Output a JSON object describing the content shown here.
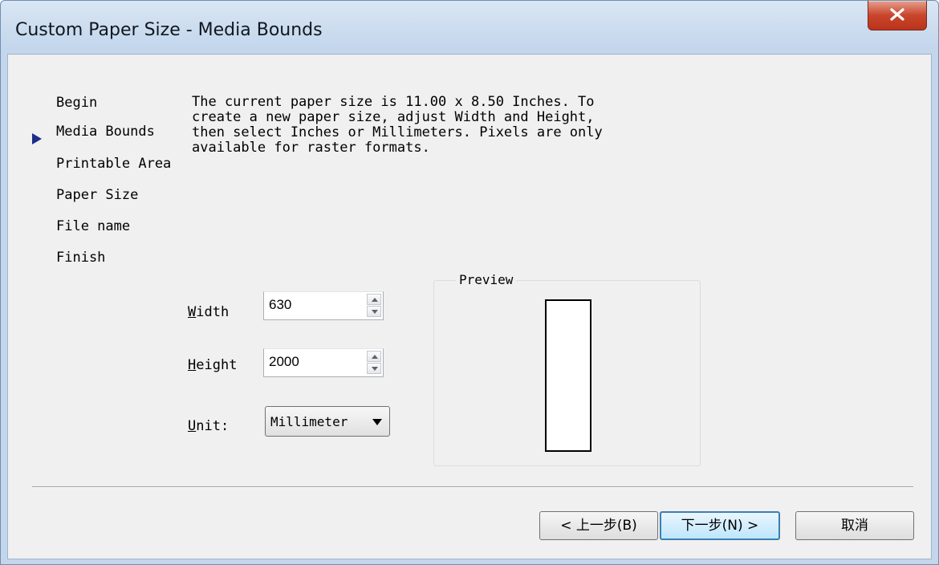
{
  "window": {
    "title": "Custom Paper Size - Media Bounds",
    "close_icon": "close-x-icon"
  },
  "nav": {
    "current_index": 1,
    "items": [
      {
        "label": "Begin"
      },
      {
        "label": "Media Bounds"
      },
      {
        "label": "Printable Area"
      },
      {
        "label": "Paper Size"
      },
      {
        "label": "File name"
      },
      {
        "label": "Finish"
      }
    ]
  },
  "description": "The current paper size is 11.00 x 8.50 Inches. To\ncreate a new paper size, adjust Width and Height,\nthen select Inches or Millimeters. Pixels are only\navailable for raster formats.",
  "fields": {
    "width": {
      "mnemonic": "W",
      "rest": "idth",
      "value": "630"
    },
    "height": {
      "mnemonic": "H",
      "rest": "eight",
      "value": "2000"
    },
    "unit": {
      "mnemonic": "U",
      "rest": "nit:",
      "value": "Millimeter"
    }
  },
  "preview": {
    "label": "Preview"
  },
  "buttons": {
    "back": "< 上一步(B)",
    "next": "下一步(N) >",
    "cancel": "取消"
  },
  "colors": {
    "accent": "#3c7fb1",
    "nav_arrow": "#1b2e8c",
    "close_button": "#c9452c"
  }
}
